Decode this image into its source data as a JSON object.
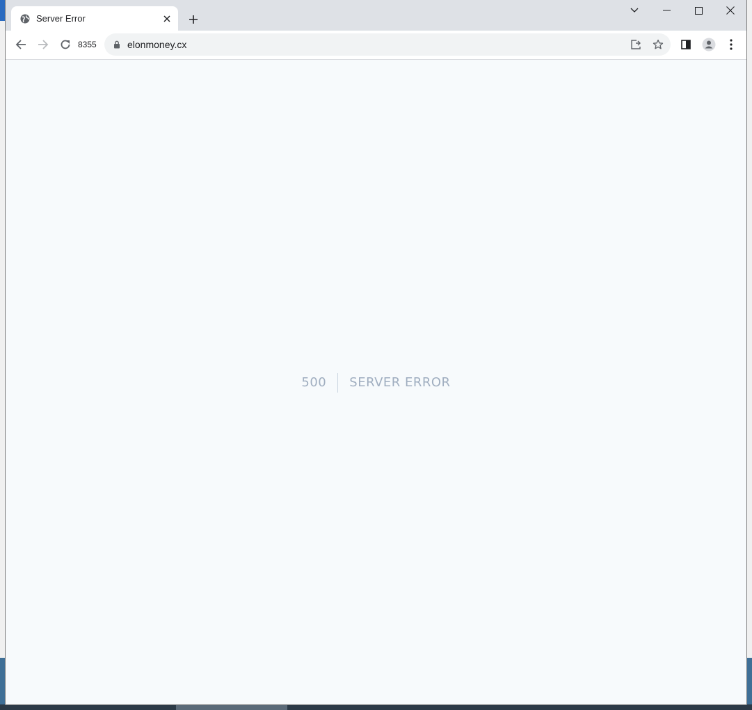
{
  "browser": {
    "tab": {
      "title": "Server Error",
      "favicon": "globe-icon"
    },
    "reload_counter": "8355",
    "address_bar": {
      "url": "elonmoney.cx",
      "security_icon": "lock-icon"
    },
    "window_controls": [
      "chevron-down-icon",
      "minimize-icon",
      "maximize-icon",
      "close-icon"
    ]
  },
  "page": {
    "error_code": "500",
    "error_message": "SERVER ERROR"
  },
  "colors": {
    "page_background": "#f7fafc",
    "error_text": "#a0aec0",
    "divider": "#cbd5e0",
    "tabstrip": "#dee1e6"
  }
}
